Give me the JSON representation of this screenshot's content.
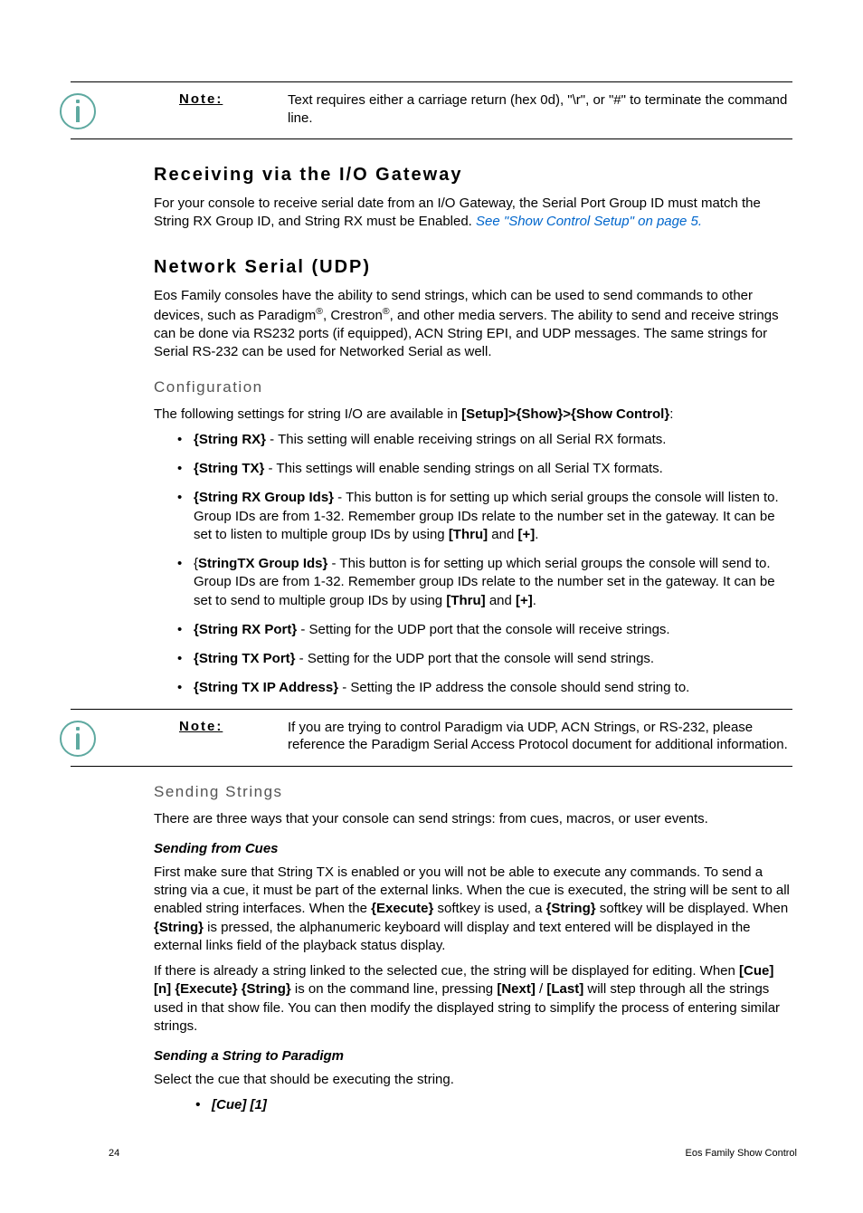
{
  "note1": {
    "label": "Note:",
    "text": "Text requires either a carriage return (hex 0d), \"\\r\", or \"#\" to terminate the command line."
  },
  "h_receiving": "Receiving via the I/O Gateway",
  "p_receiving": "For your console to receive serial date from an I/O Gateway, the Serial Port Group ID must match the String RX Group ID, and String RX must be Enabled. ",
  "link_receiving": "See \"Show Control Setup\" on page 5.",
  "h_network": "Network Serial (UDP)",
  "p_network_pre": "Eos Family consoles have the ability to send strings, which can be used to send commands to other devices, such as Paradigm",
  "p_network_mid": ", Crestron",
  "p_network_post": ", and other media servers. The ability to send and receive strings can be done via RS232 ports (if equipped), ACN String EPI, and UDP messages. The same strings for Serial RS-232 can be used for Networked Serial as well.",
  "h_config": "Configuration",
  "p_config_intro_pre": "The following settings for string I/O are available in ",
  "p_config_intro_bold": "[Setup]>{Show}>{Show Control}",
  "bullets": {
    "b1_label": "{String RX}",
    "b1_text": " - This setting will enable receiving strings on all Serial RX formats.",
    "b2_label": "{String TX}",
    "b2_text": " - This settings will enable sending strings on all Serial TX formats.",
    "b3_label": "{String RX Group Ids}",
    "b3_text_a": " - This button is for setting up which serial groups the console will listen to. Group IDs are from 1-32. Remember group IDs relate to the number set in the gateway. It can be set to listen to multiple group IDs by using ",
    "b3_thru": "[Thru]",
    "b3_and": " and ",
    "b3_plus": "[+]",
    "b4_label": "StringTX Group Ids}",
    "b4_text_a": " - This button is for setting up which serial groups the console will send to. Group IDs are from 1-32. Remember group IDs relate to the number set in the gateway. It can be set to send to multiple group IDs by using ",
    "b5_label": "{String RX Port}",
    "b5_text": " - Setting for the UDP port that the console will receive strings.",
    "b6_label": "{String TX Port}",
    "b6_text": " - Setting for the UDP port that the console will send strings.",
    "b7_label": "{String TX IP Address}",
    "b7_text": " - Setting the IP address the console should send string to."
  },
  "note2": {
    "label": "Note:",
    "text": "If you are trying to control Paradigm via UDP, ACN Strings, or RS-232, please reference the Paradigm Serial Access Protocol document for additional information."
  },
  "h_sending": "Sending Strings",
  "p_sending_intro": "There are three ways that your console can send strings: from cues, macros, or user events.",
  "h_sending_cues": "Sending from Cues",
  "p_cues_1_a": "First make sure that String TX is enabled or you will not be able to execute any commands. To send a string via a cue, it must be part of the external links. When the cue is executed, the string will be sent to all enabled string interfaces. When the ",
  "p_cues_1_exec": "{Execute}",
  "p_cues_1_b": " softkey is used, a ",
  "p_cues_1_string": "{String}",
  "p_cues_1_c": " softkey will be displayed. When ",
  "p_cues_1_d": " is pressed, the alphanumeric keyboard will display and text entered will be displayed in the external links field of the playback status display.",
  "p_cues_2_a": "If there is already a string linked to the selected cue, the string will be displayed for editing. When ",
  "p_cues_2_cmd": "[Cue] [n] {Execute} {String}",
  "p_cues_2_b": " is on the command line, pressing ",
  "p_cues_2_next": "[Next]",
  "p_cues_2_slash": " / ",
  "p_cues_2_last": "[Last]",
  "p_cues_2_c": " will step through all the strings used in that show file. You can then modify the displayed string to simplify the process of entering similar strings.",
  "h_paradigm": "Sending a String to Paradigm",
  "p_paradigm": "Select the cue that should be executing the string.",
  "nested_item": "[Cue] [1]",
  "footer": {
    "page": "24",
    "title": "Eos Family Show Control"
  }
}
